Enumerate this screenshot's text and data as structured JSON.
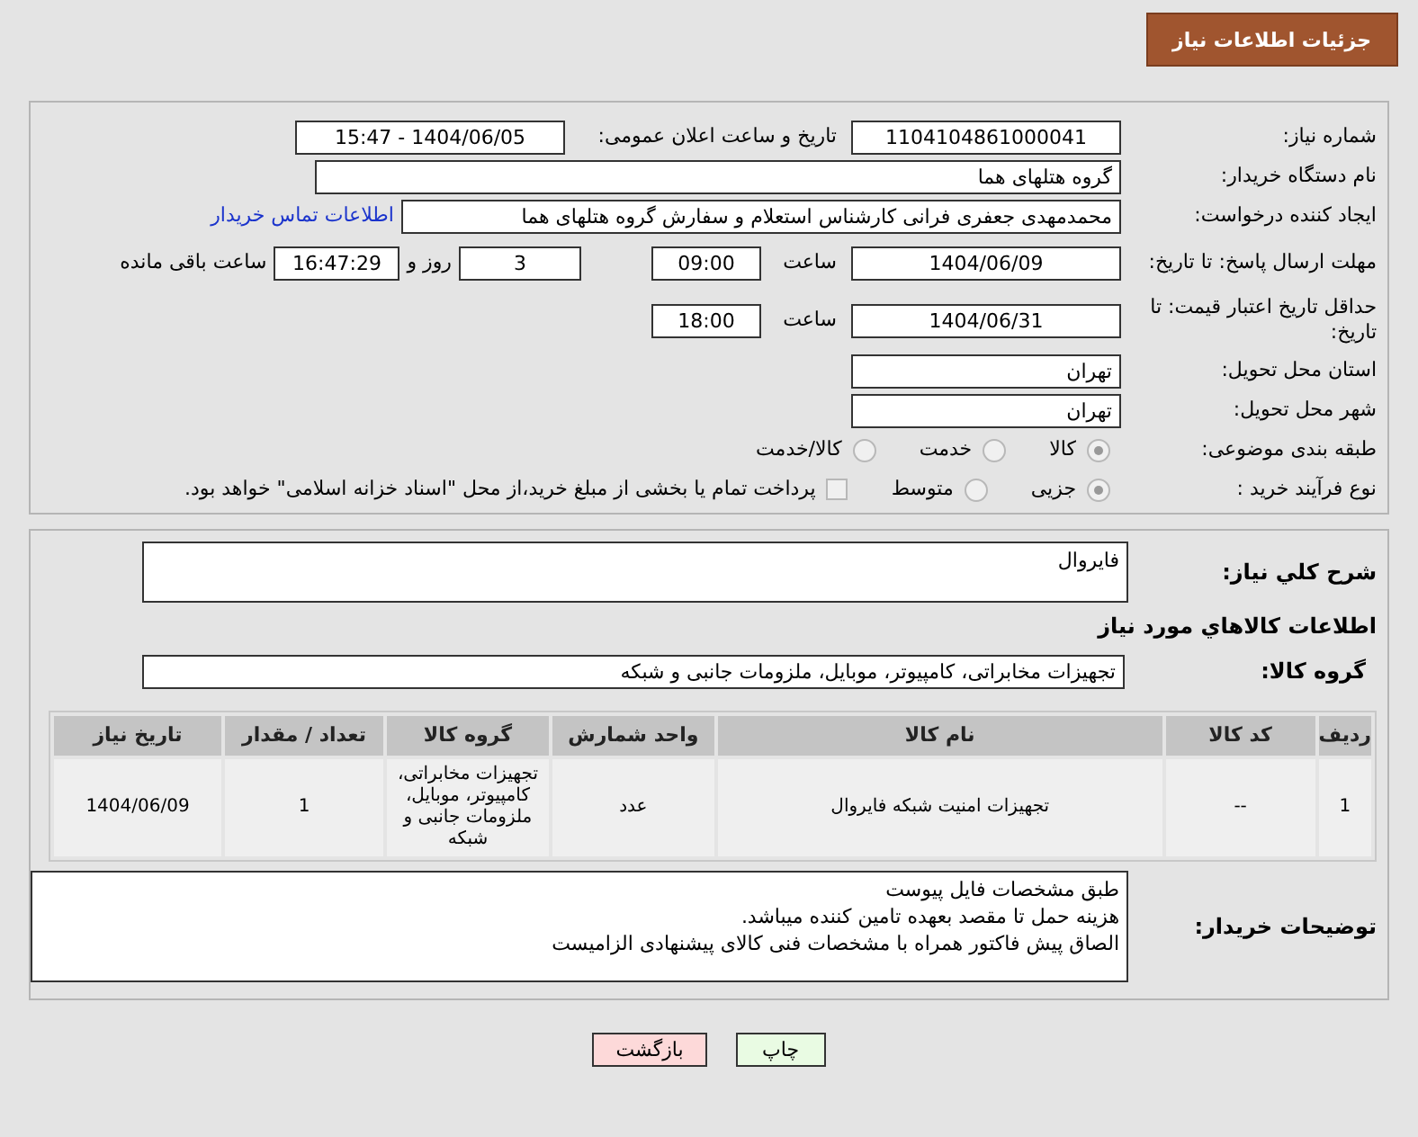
{
  "header": {
    "title": "جزئیات اطلاعات نیاز"
  },
  "need_number": {
    "label": "شماره نیاز:",
    "value": "1104104861000041"
  },
  "announce": {
    "label": "تاریخ و ساعت اعلان عمومی:",
    "value": "1404/06/05 - 15:47"
  },
  "buyer": {
    "label": "نام دستگاه خریدار:",
    "value": "گروه هتلهای هما"
  },
  "creator": {
    "label": "ایجاد کننده درخواست:",
    "value": "محمدمهدی جعفری فرانی کارشناس استعلام و سفارش گروه هتلهای هما",
    "link": "اطلاعات تماس خریدار"
  },
  "deadline": {
    "label": "مهلت ارسال پاسخ: تا تاریخ:",
    "date": "1404/06/09",
    "time_label": "ساعت",
    "time": "09:00",
    "days": "3",
    "days_label": "روز و",
    "remaining": "16:47:29",
    "remaining_label": "ساعت باقی مانده"
  },
  "validity": {
    "label": "حداقل تاریخ اعتبار قیمت: تا تاریخ:",
    "date": "1404/06/31",
    "time_label": "ساعت",
    "time": "18:00"
  },
  "province": {
    "label": "استان محل تحویل:",
    "value": "تهران"
  },
  "city": {
    "label": "شهر محل تحویل:",
    "value": "تهران"
  },
  "category": {
    "label": "طبقه بندی موضوعی:",
    "options": [
      {
        "label": "کالا",
        "selected": true
      },
      {
        "label": "خدمت",
        "selected": false
      },
      {
        "label": "کالا/خدمت",
        "selected": false
      }
    ]
  },
  "process": {
    "label": "نوع فرآیند خرید :",
    "options": [
      {
        "label": "جزیی",
        "selected": true
      },
      {
        "label": "متوسط",
        "selected": false
      }
    ],
    "treasury": {
      "label": "پرداخت تمام یا بخشی از مبلغ خرید،از محل \"اسناد خزانه اسلامی\" خواهد بود.",
      "checked": false
    }
  },
  "description": {
    "label": "شرح کلي نياز:",
    "value": "فایروال"
  },
  "goods_heading": "اطلاعات كالاهاي مورد نياز",
  "goods_group": {
    "label": "گروه کالا:",
    "value": "تجهیزات مخابراتی، کامپیوتر، موبایل، ملزومات جانبی و شبکه"
  },
  "table": {
    "columns": [
      "ردیف",
      "کد کالا",
      "نام کالا",
      "واحد شمارش",
      "گروه کالا",
      "تعداد / مقدار",
      "تاریخ نیاز"
    ],
    "rows": [
      [
        "1",
        "--",
        "تجهیزات امنیت شبکه فایروال",
        "عدد",
        "تجهیزات مخابراتی، کامپیوتر، موبایل، ملزومات جانبی و شبکه",
        "1",
        "1404/06/09"
      ]
    ]
  },
  "notes": {
    "label": "توضیحات خریدار:",
    "lines": [
      "طبق مشخصات فایل پیوست",
      "هزینه حمل تا مقصد بعهده تامین کننده میباشد.",
      "الصاق پیش فاکتور همراه با مشخصات فنی کالای پیشنهادی الزامیست"
    ]
  },
  "buttons": [
    {
      "label": "چاپ",
      "kind": "print"
    },
    {
      "label": "بازگشت",
      "kind": "back"
    }
  ]
}
